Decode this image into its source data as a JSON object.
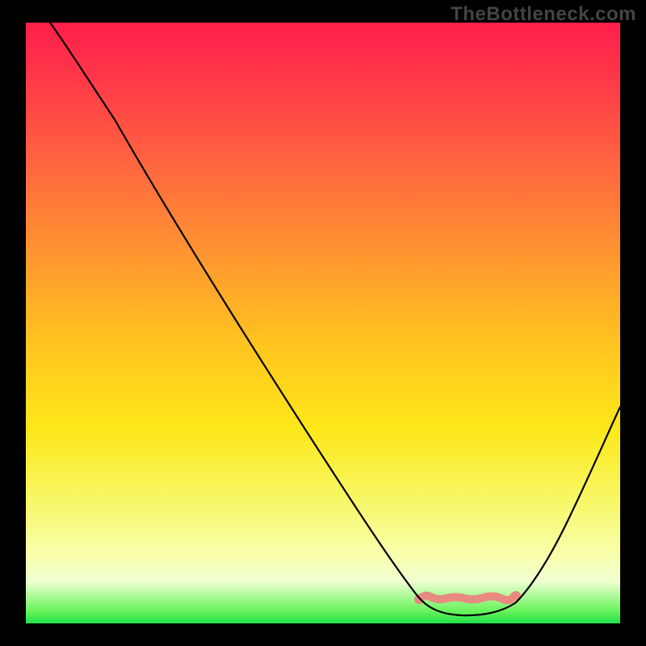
{
  "watermark": "TheBottleneck.com",
  "chart_data": {
    "type": "line",
    "title": "",
    "xlabel": "",
    "ylabel": "",
    "xlim": [
      0,
      100
    ],
    "ylim": [
      0,
      100
    ],
    "grid": false,
    "legend": false,
    "background_gradient": {
      "top_color": "#ff1e4b",
      "bottom_color": "#1fe04a",
      "description": "vertical gradient red→orange→yellow→green"
    },
    "series": [
      {
        "name": "bottleneck-curve",
        "description": "V-shaped curve: steep descent from top-left to a flat minimum around x≈68–82, then rising toward top-right",
        "points_xy": [
          [
            4,
            100
          ],
          [
            8,
            96
          ],
          [
            15,
            88
          ],
          [
            25,
            72
          ],
          [
            35,
            56
          ],
          [
            45,
            40
          ],
          [
            55,
            24
          ],
          [
            62,
            11
          ],
          [
            66,
            4
          ],
          [
            69,
            1.2
          ],
          [
            73,
            0.6
          ],
          [
            78,
            0.8
          ],
          [
            82,
            1.6
          ],
          [
            85,
            4
          ],
          [
            90,
            13
          ],
          [
            95,
            24
          ],
          [
            100,
            36
          ]
        ],
        "optimal_zone_x": [
          68,
          82
        ]
      }
    ],
    "highlight": {
      "color": "#e88a80",
      "description": "semi-transparent salmon squiggle along the flat valley with small dots at the ends"
    }
  }
}
